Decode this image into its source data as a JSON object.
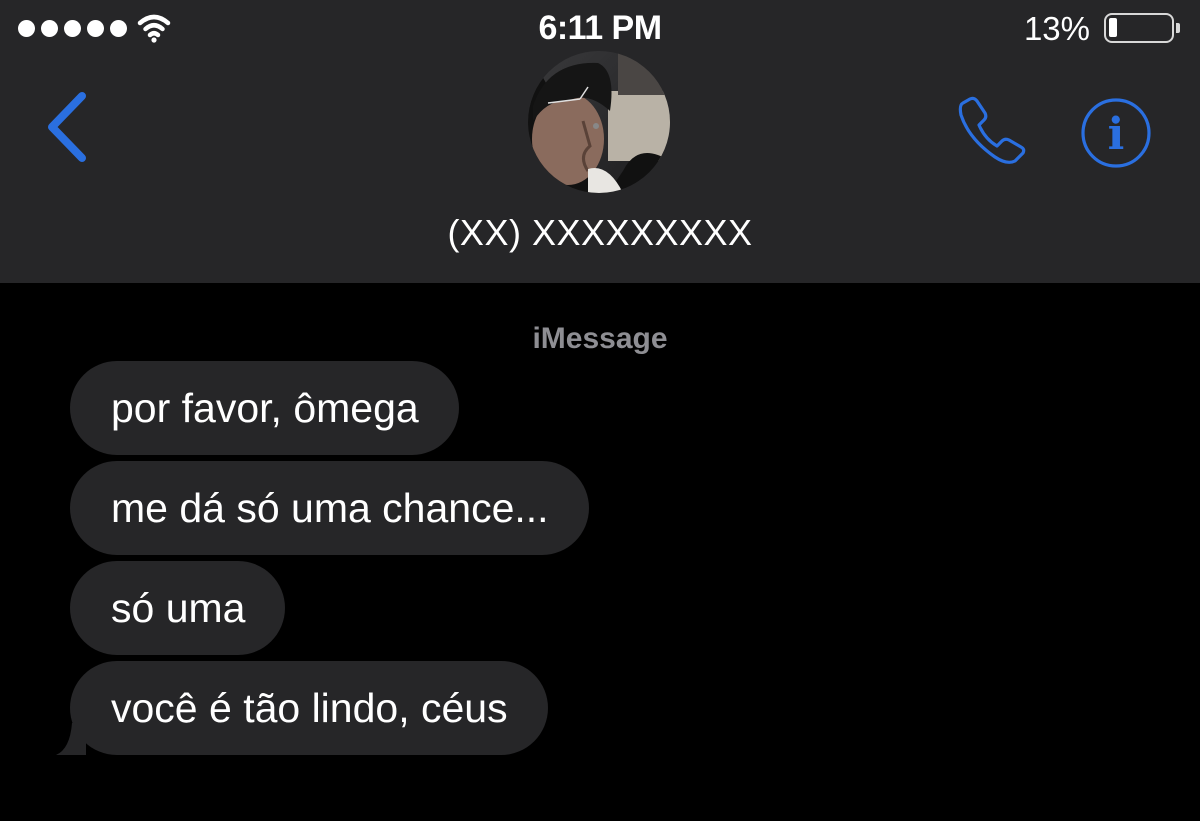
{
  "status_bar": {
    "signal_bars": 5,
    "wifi_icon": "wifi-icon",
    "time": "6:11 PM",
    "battery_percent": "13%",
    "battery_level": 0.13
  },
  "header": {
    "back_icon": "chevron-left-icon",
    "contact_name": "(XX) XXXXXXXXX",
    "call_icon": "phone-icon",
    "info_icon": "info-icon",
    "accent_color": "#2a6fe0"
  },
  "conversation": {
    "service_label": "iMessage",
    "messages": [
      {
        "text": "por favor, ômega",
        "direction": "incoming"
      },
      {
        "text": "me dá só uma chance...",
        "direction": "incoming"
      },
      {
        "text": "só uma",
        "direction": "incoming"
      },
      {
        "text": "você é tão lindo, céus",
        "direction": "incoming"
      }
    ],
    "bubble_color": "#262628",
    "background_color": "#000000"
  }
}
